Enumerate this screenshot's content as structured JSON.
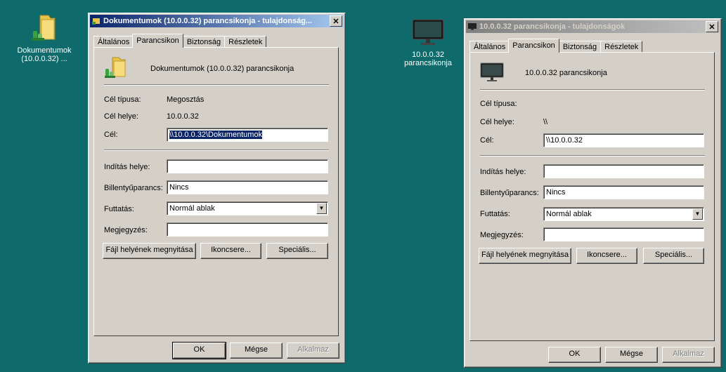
{
  "desktop": {
    "icon1": {
      "label_line1": "Dokumentumok",
      "label_line2": "(10.0.0.32) ..."
    },
    "icon2": {
      "label_line1": "10.0.0.32",
      "label_line2": "parancsikonja"
    }
  },
  "window1": {
    "title": "Dokumentumok (10.0.0.32) parancsikonja - tulajdonság...",
    "close_label": "✕",
    "tabs": [
      "Általános",
      "Parancsikon",
      "Biztonság",
      "Részletek"
    ],
    "header_name": "Dokumentumok (10.0.0.32) parancsikonja",
    "target_type_label": "Cél típusa:",
    "target_type_value": "Megosztás",
    "target_location_label": "Cél helye:",
    "target_location_value": "10.0.0.32",
    "target_label": "Cél:",
    "target_value": "\\\\10.0.0.32\\Dokumentumok",
    "start_in_label": "Indítás helye:",
    "start_in_value": "",
    "shortcut_key_label": "Billentyűparancs:",
    "shortcut_key_value": "Nincs",
    "run_label": "Futtatás:",
    "run_value": "Normál ablak",
    "comment_label": "Megjegyzés:",
    "comment_value": "",
    "open_location_button": "Fájl helyének megnyitása",
    "change_icon_button": "Ikoncsere...",
    "advanced_button": "Speciális...",
    "ok_button": "OK",
    "cancel_button": "Mégse",
    "apply_button": "Alkalmaz"
  },
  "window2": {
    "title": "10.0.0.32 parancsikonja - tulajdonságok",
    "close_label": "✕",
    "tabs": [
      "Általános",
      "Parancsikon",
      "Biztonság",
      "Részletek"
    ],
    "header_name": "10.0.0.32 parancsikonja",
    "target_type_label": "Cél típusa:",
    "target_type_value": "",
    "target_location_label": "Cél helye:",
    "target_location_value": "\\\\",
    "target_label": "Cél:",
    "target_value": "\\\\10.0.0.32",
    "start_in_label": "Indítás helye:",
    "start_in_value": "",
    "shortcut_key_label": "Billentyűparancs:",
    "shortcut_key_value": "Nincs",
    "run_label": "Futtatás:",
    "run_value": "Normál ablak",
    "comment_label": "Megjegyzés:",
    "comment_value": "",
    "open_location_button": "Fájl helyének megnyitása",
    "change_icon_button": "Ikoncsere...",
    "advanced_button": "Speciális...",
    "ok_button": "OK",
    "cancel_button": "Mégse",
    "apply_button": "Alkalmaz"
  },
  "icons": {
    "folder_shortcut": "network-folder-shortcut-icon",
    "monitor": "monitor-icon",
    "dropdown": "chevron-down-icon"
  },
  "colors": {
    "desktop": "#0f6b6b",
    "title_active": "#0a246a",
    "title_inactive": "#808080",
    "dialog_face": "#d4d0c8",
    "selection": "#0a246a"
  }
}
